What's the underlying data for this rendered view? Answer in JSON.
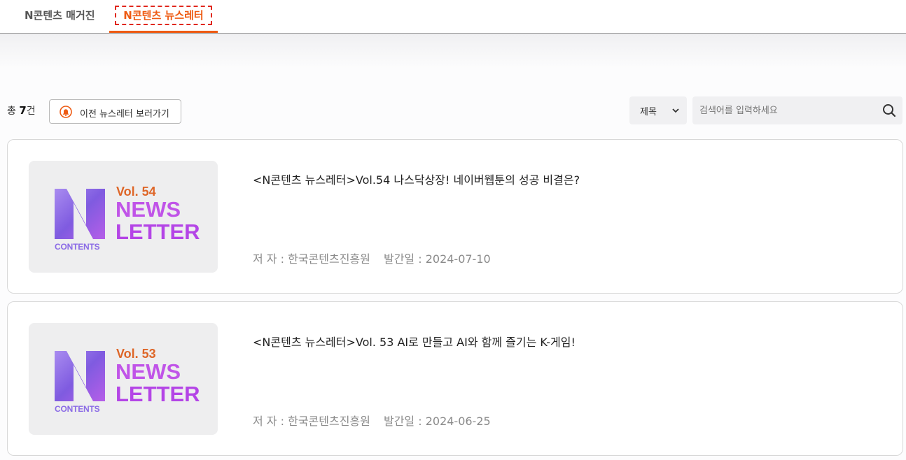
{
  "tabs": [
    {
      "label": "N콘텐츠 매거진",
      "active": false
    },
    {
      "label": "N콘텐츠 뉴스레터",
      "active": true
    }
  ],
  "toolbar": {
    "count_prefix": "총",
    "count_value": "7",
    "count_suffix": "건",
    "prev_button_label": "이전 뉴스레터 보러가기",
    "prev_button_icon": "bell-icon"
  },
  "search": {
    "select_value": "제목",
    "placeholder": "검색어를 입력하세요",
    "icon": "search-icon"
  },
  "colors": {
    "accent": "#ee5a12",
    "dashed_outline": "#e0281e",
    "vol_text": "#de6628",
    "newsletter_text": "#c054e8"
  },
  "items": [
    {
      "title": "<N콘텐츠 뉴스레터>Vol.54 나스닥상장! 네이버웹툰의 성공 비결은?",
      "author_label": "저 자 :",
      "author": "한국콘텐츠진흥원",
      "date_label": "발간일 :",
      "date": "2024-07-10",
      "thumb": {
        "vol": "Vol. 54",
        "line1": "NEWS",
        "line2": "LETTER",
        "logo_letter": "N",
        "logo_text": "CONTENTS"
      }
    },
    {
      "title": "<N콘텐츠 뉴스레터>Vol. 53 AI로 만들고 AI와 함께 즐기는 K-게임!",
      "author_label": "저 자 :",
      "author": "한국콘텐츠진흥원",
      "date_label": "발간일 :",
      "date": "2024-06-25",
      "thumb": {
        "vol": "Vol. 53",
        "line1": "NEWS",
        "line2": "LETTER",
        "logo_letter": "N",
        "logo_text": "CONTENTS"
      }
    }
  ]
}
